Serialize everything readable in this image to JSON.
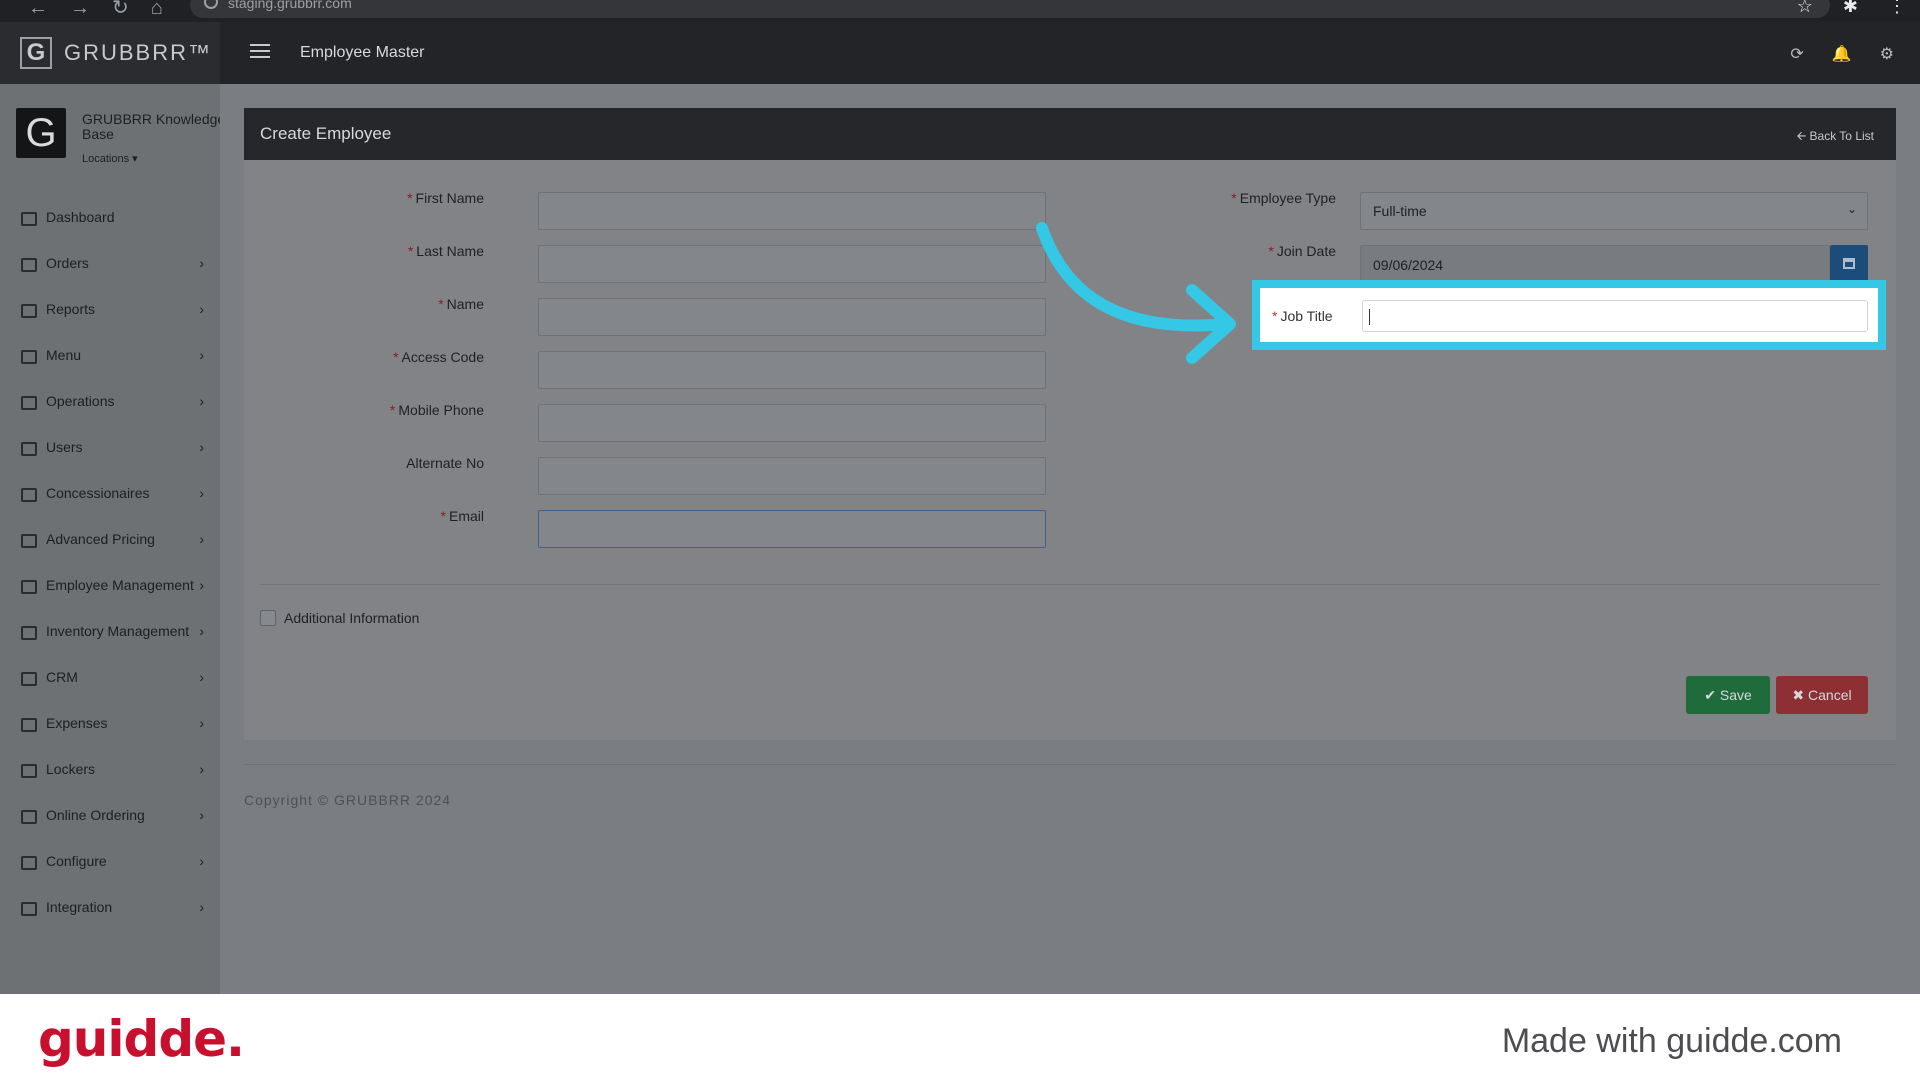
{
  "browser": {
    "url": "staging.grubbrr.com",
    "nav_icons": [
      "←",
      "→",
      "↻",
      "⌂"
    ],
    "right_icons": [
      "☆",
      "✱",
      "⋮"
    ]
  },
  "header": {
    "brand_letter": "G",
    "brand": "GRUBBRR™",
    "title": "Employee Master",
    "icons": [
      "⟳",
      "🔔",
      "⚙"
    ]
  },
  "sidebar": {
    "logo_letter": "G",
    "org_name": "GRUBBRR Knowledge Base",
    "locations_label": "Locations ▾",
    "items": [
      {
        "label": "Dashboard",
        "chevron": ""
      },
      {
        "label": "Orders",
        "chevron": "›"
      },
      {
        "label": "Reports",
        "chevron": "›"
      },
      {
        "label": "Menu",
        "chevron": "›"
      },
      {
        "label": "Operations",
        "chevron": "›"
      },
      {
        "label": "Users",
        "chevron": "›"
      },
      {
        "label": "Concessionaires",
        "chevron": "›"
      },
      {
        "label": "Advanced Pricing",
        "chevron": "›"
      },
      {
        "label": "Employee Management",
        "chevron": "›"
      },
      {
        "label": "Inventory Management",
        "chevron": "›"
      },
      {
        "label": "CRM",
        "chevron": "›"
      },
      {
        "label": "Expenses",
        "chevron": "›"
      },
      {
        "label": "Lockers",
        "chevron": "›"
      },
      {
        "label": "Online Ordering",
        "chevron": "›"
      },
      {
        "label": "Configure",
        "chevron": "›"
      },
      {
        "label": "Integration",
        "chevron": "›"
      }
    ]
  },
  "card": {
    "title": "Create Employee",
    "back_link": "🡨 Back To List"
  },
  "form": {
    "required_mark": "*",
    "first_name_label": "First Name",
    "last_name_label": "Last Name",
    "name_label": "Name",
    "access_code_label": "Access Code",
    "mobile_phone_label": "Mobile Phone",
    "alternate_no_label": "Alternate No",
    "email_label": "Email",
    "employee_type_label": "Employee Type",
    "employee_type_value": "Full-time",
    "join_date_label": "Join Date",
    "join_date_value": "09/06/2024",
    "job_title_label": "Job Title",
    "additional_info_label": "Additional Information",
    "save_label": "✔ Save",
    "cancel_label": "✖ Cancel"
  },
  "copyright": "Copyright © GRUBBRR 2024",
  "footer": {
    "logo": "guidde.",
    "made_with": "Made with guidde.com"
  },
  "colors": {
    "highlight": "#35c7e6",
    "brand_red": "#c8102e"
  }
}
